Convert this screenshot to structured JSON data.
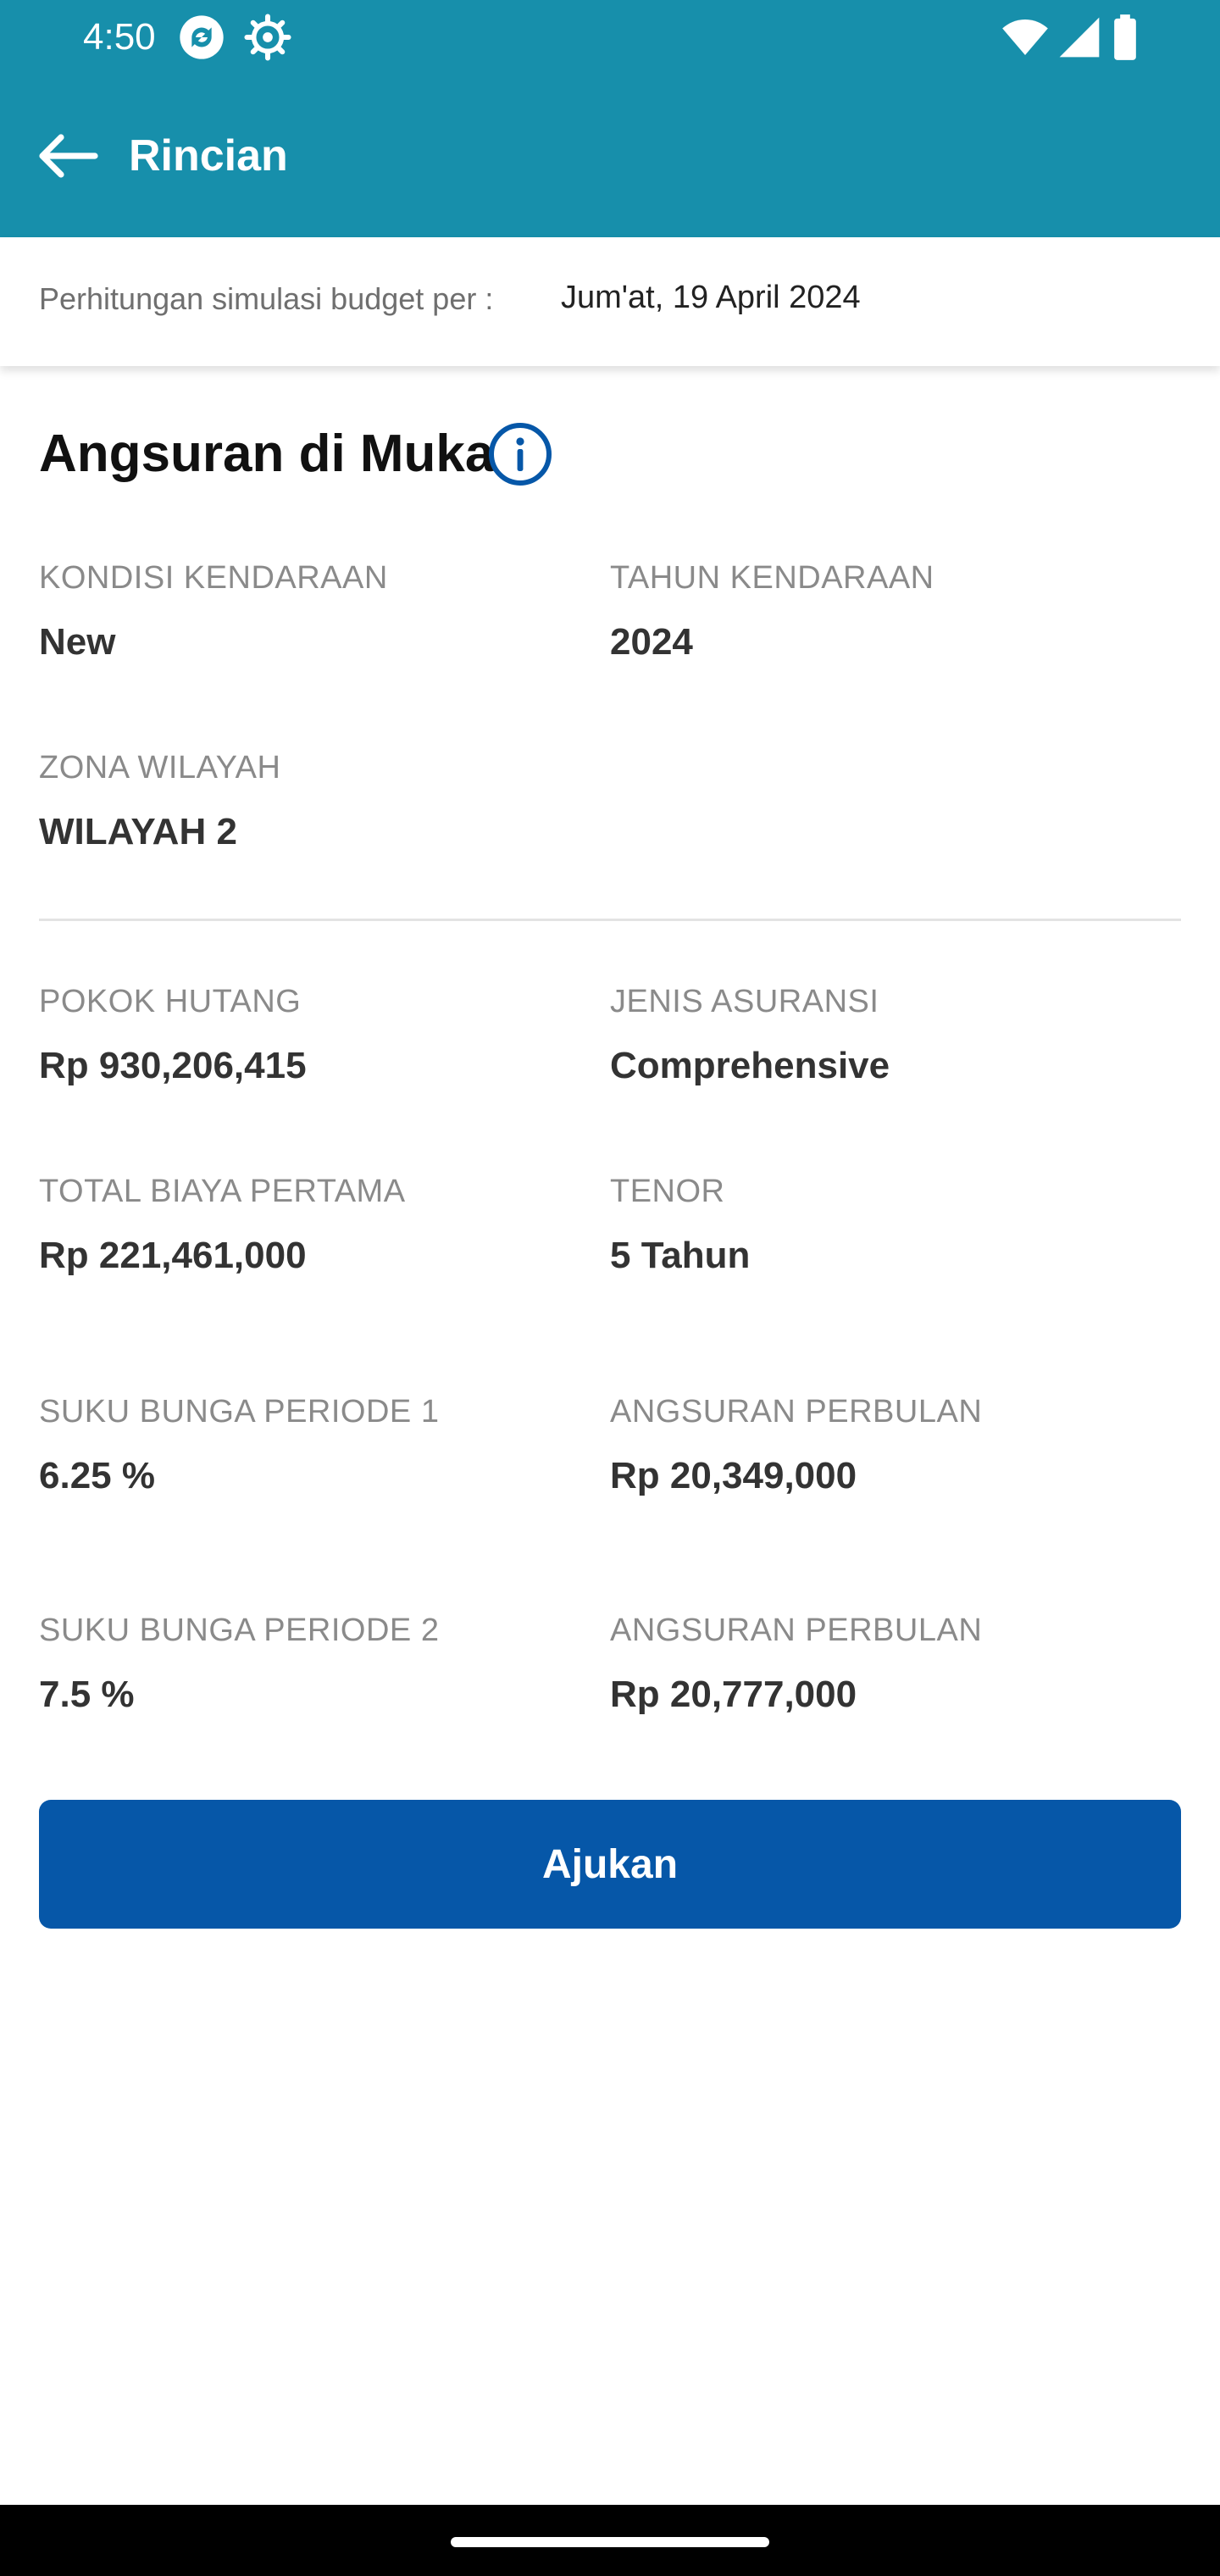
{
  "status_bar": {
    "time": "4:50"
  },
  "header": {
    "title": "Rincian"
  },
  "simulation": {
    "label": "Perhitungan simulasi budget per :",
    "date": "Jum'at, 19 April 2024"
  },
  "section": {
    "title": "Angsuran di Muka"
  },
  "fields": {
    "kondisi": {
      "label": "KONDISI KENDARAAN",
      "value": "New"
    },
    "tahun": {
      "label": "TAHUN KENDARAAN",
      "value": "2024"
    },
    "zona": {
      "label": "ZONA WILAYAH",
      "value": "WILAYAH 2"
    },
    "pokok": {
      "label": "POKOK HUTANG",
      "value": "Rp 930,206,415"
    },
    "asuransi": {
      "label": "JENIS ASURANSI",
      "value": "Comprehensive"
    },
    "biaya": {
      "label": "TOTAL BIAYA PERTAMA",
      "value": "Rp 221,461,000"
    },
    "tenor": {
      "label": "TENOR",
      "value": "5 Tahun"
    },
    "bunga1": {
      "label": "SUKU BUNGA PERIODE 1",
      "value": "6.25 %"
    },
    "angsuran1": {
      "label": "ANGSURAN PERBULAN",
      "value": "Rp 20,349,000"
    },
    "bunga2": {
      "label": "SUKU BUNGA PERIODE 2",
      "value": "7.5 %"
    },
    "angsuran2": {
      "label": "ANGSURAN PERBULAN",
      "value": "Rp 20,777,000"
    }
  },
  "submit_label": "Ajukan",
  "colors": {
    "header": "#178FAB",
    "button": "#0657A8",
    "info_icon": "#0657A8"
  },
  "icons": [
    "sync-icon",
    "settings-icon",
    "wifi-icon",
    "signal-icon",
    "battery-icon",
    "back-arrow-icon",
    "info-icon"
  ]
}
